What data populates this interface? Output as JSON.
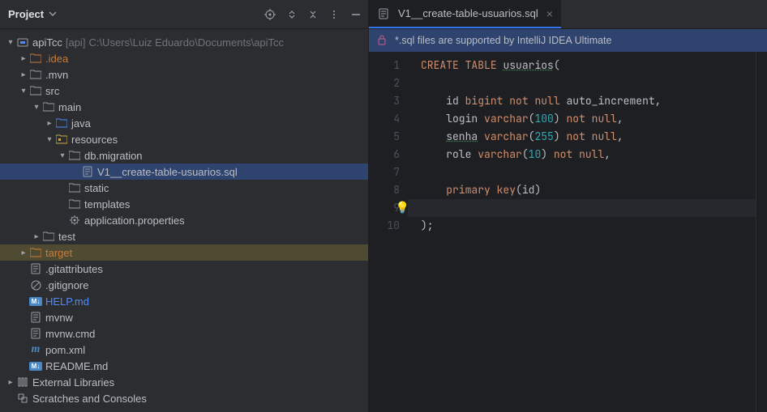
{
  "sidebar": {
    "title": "Project",
    "project": {
      "name": "apiTcc",
      "scope": "[api]",
      "path": "C:\\Users\\Luiz Eduardo\\Documents\\apiTcc"
    },
    "nodes": {
      "idea": ".idea",
      "mvn": ".mvn",
      "src": "src",
      "main": "main",
      "java": "java",
      "resources": "resources",
      "dbmig": "db.migration",
      "sqlfile": "V1__create-table-usuarios.sql",
      "static": "static",
      "templates": "templates",
      "appprops": "application.properties",
      "test": "test",
      "target": "target",
      "gitattr": ".gitattributes",
      "gitignore": ".gitignore",
      "help": "HELP.md",
      "mvnw": "mvnw",
      "mvnwcmd": "mvnw.cmd",
      "pom": "pom.xml",
      "readme": "README.md",
      "extlib": "External Libraries",
      "scratch": "Scratches and Consoles"
    }
  },
  "tab": {
    "title": "V1__create-table-usuarios.sql"
  },
  "banner": {
    "text": "*.sql files are supported by IntelliJ IDEA Ultimate"
  },
  "code": {
    "gutter": [
      "1",
      "2",
      "3",
      "4",
      "5",
      "6",
      "7",
      "8",
      "9",
      "10"
    ],
    "t": {
      "create": "CREATE",
      "table": "TABLE",
      "usuarios": "usuarios",
      "op": "(",
      "id": "id",
      "bigint": "bigint",
      "notnull": "not null",
      "autoinc": "auto_increment",
      "comma": ",",
      "login": "login",
      "varchar": "varchar",
      "n100": "100",
      "cp": ")",
      "senha": "senha",
      "n255": "255",
      "role": "role",
      "n10": "10",
      "primary": "primary",
      "key": "key",
      "opid": "(",
      "idref": "id",
      "cpid": ")",
      "close": ");"
    }
  }
}
